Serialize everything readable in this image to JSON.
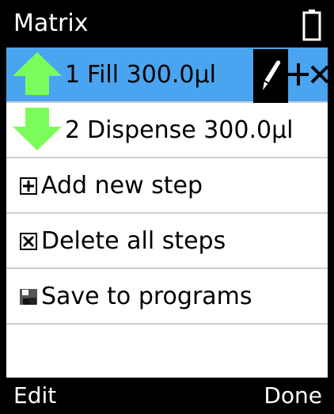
{
  "header": {
    "title": "Matrix",
    "battery_icon": "battery-icon"
  },
  "steps": [
    {
      "number": "1",
      "text": "Fill 300.0µl",
      "icon": "arrow-up-icon"
    },
    {
      "number": "2",
      "text": "Dispense 300.0µl",
      "icon": "arrow-down-icon"
    }
  ],
  "actions": [
    {
      "label": "Add new step",
      "icon": "plus-box-icon"
    },
    {
      "label": "Delete all steps",
      "icon": "x-box-icon"
    },
    {
      "label": "Save to programs",
      "icon": "save-icon"
    }
  ],
  "footer": {
    "left_label": "Edit",
    "right_label": "Done"
  },
  "colors": {
    "selected_bg": "#4aa4ef",
    "arrow_green": "#7CFC5A"
  }
}
